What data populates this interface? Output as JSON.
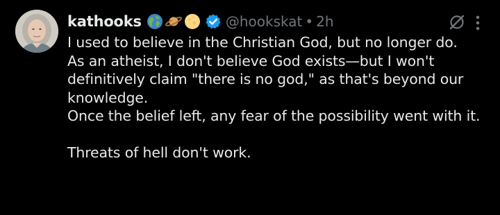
{
  "post": {
    "display_name": "kathooks",
    "handle": "@hookskat",
    "separator": "•",
    "time": "2h",
    "emojis": [
      "globe-americas-emoji",
      "ringed-planet-emoji",
      "full-moon-emoji"
    ],
    "verified": true,
    "text_lines": [
      "I used to believe in the Christian God, but no longer do.",
      "As an atheist, I don't believe God exists—but I won't definitively claim \"there is no god,\" as that's beyond our knowledge.",
      "Once the belief left, any fear of the possibility went with it.",
      "Threats of hell don't work."
    ]
  },
  "colors": {
    "background": "#000000",
    "text_primary": "#e7e9ea",
    "text_secondary": "#71767b",
    "verified_blue": "#1d9bf0"
  },
  "icons": {
    "verified": "verified-badge-icon",
    "grok": "grok-icon",
    "more": "more-options-icon"
  }
}
